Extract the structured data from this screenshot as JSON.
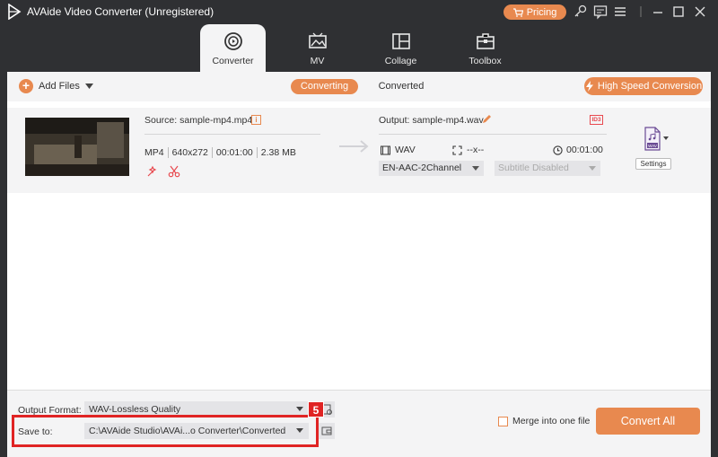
{
  "app": {
    "title": "AVAide Video Converter (Unregistered)",
    "pricing_label": "Pricing",
    "accent_color": "#e8894f"
  },
  "tabs": [
    {
      "label": "Converter",
      "icon": "converter-icon",
      "active": true
    },
    {
      "label": "MV",
      "icon": "mv-icon",
      "active": false
    },
    {
      "label": "Collage",
      "icon": "collage-icon",
      "active": false
    },
    {
      "label": "Toolbox",
      "icon": "toolbox-icon",
      "active": false
    }
  ],
  "toolbar": {
    "add_files_label": "Add Files",
    "converting_label": "Converting",
    "converted_label": "Converted",
    "high_speed_label": "High Speed Conversion"
  },
  "file": {
    "source_label": "Source: sample-mp4.mp4",
    "format": "MP4",
    "resolution": "640x272",
    "duration": "00:01:00",
    "size": "2.38 MB",
    "output_label": "Output: sample-mp4.wav",
    "out_format": "WAV",
    "out_resolution": "--x--",
    "out_duration": "00:01:00",
    "audio_track": "EN-AAC-2Channel",
    "subtitle": "Subtitle Disabled",
    "settings_label": "Settings",
    "id3_label": "ID3",
    "format_badge": "WAV"
  },
  "bottom": {
    "output_format_label": "Output Format:",
    "output_format_value": "WAV-Lossless Quality",
    "save_to_label": "Save to:",
    "save_to_value": "C:\\AVAide Studio\\AVAi...o Converter\\Converted",
    "step_badge": "5",
    "merge_label": "Merge into one file",
    "convert_all_label": "Convert All"
  }
}
